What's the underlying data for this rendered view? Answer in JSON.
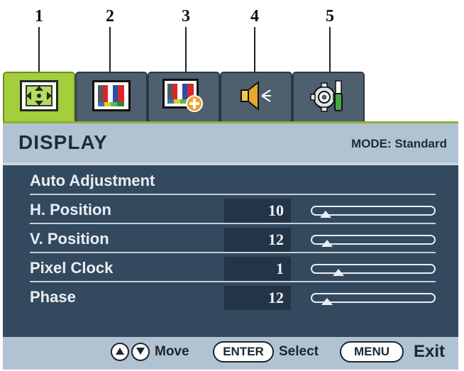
{
  "callouts": [
    "1",
    "2",
    "3",
    "4",
    "5"
  ],
  "tabs": [
    {
      "icon": "display-adjust-icon",
      "active": true
    },
    {
      "icon": "picture-icon",
      "active": false
    },
    {
      "icon": "picture-advanced-icon",
      "active": false
    },
    {
      "icon": "audio-icon",
      "active": false
    },
    {
      "icon": "system-settings-icon",
      "active": false
    }
  ],
  "header": {
    "title": "DISPLAY",
    "mode": "MODE: Standard"
  },
  "menu": {
    "auto_adjust": "Auto Adjustment",
    "items": [
      {
        "label": "H. Position",
        "value": "10",
        "level": 0.05
      },
      {
        "label": "V. Position",
        "value": "12",
        "level": 0.06
      },
      {
        "label": "Pixel Clock",
        "value": "1",
        "level": 0.17
      },
      {
        "label": "Phase",
        "value": "12",
        "level": 0.06
      }
    ]
  },
  "footer": {
    "move": "Move",
    "enter": "ENTER",
    "select": "Select",
    "menu": "MENU",
    "exit": "Exit"
  },
  "colors": {
    "active_tab": "#a4ce3c",
    "tab": "#4e5f70",
    "header": "#b1c2d2",
    "content": "#33495e"
  }
}
